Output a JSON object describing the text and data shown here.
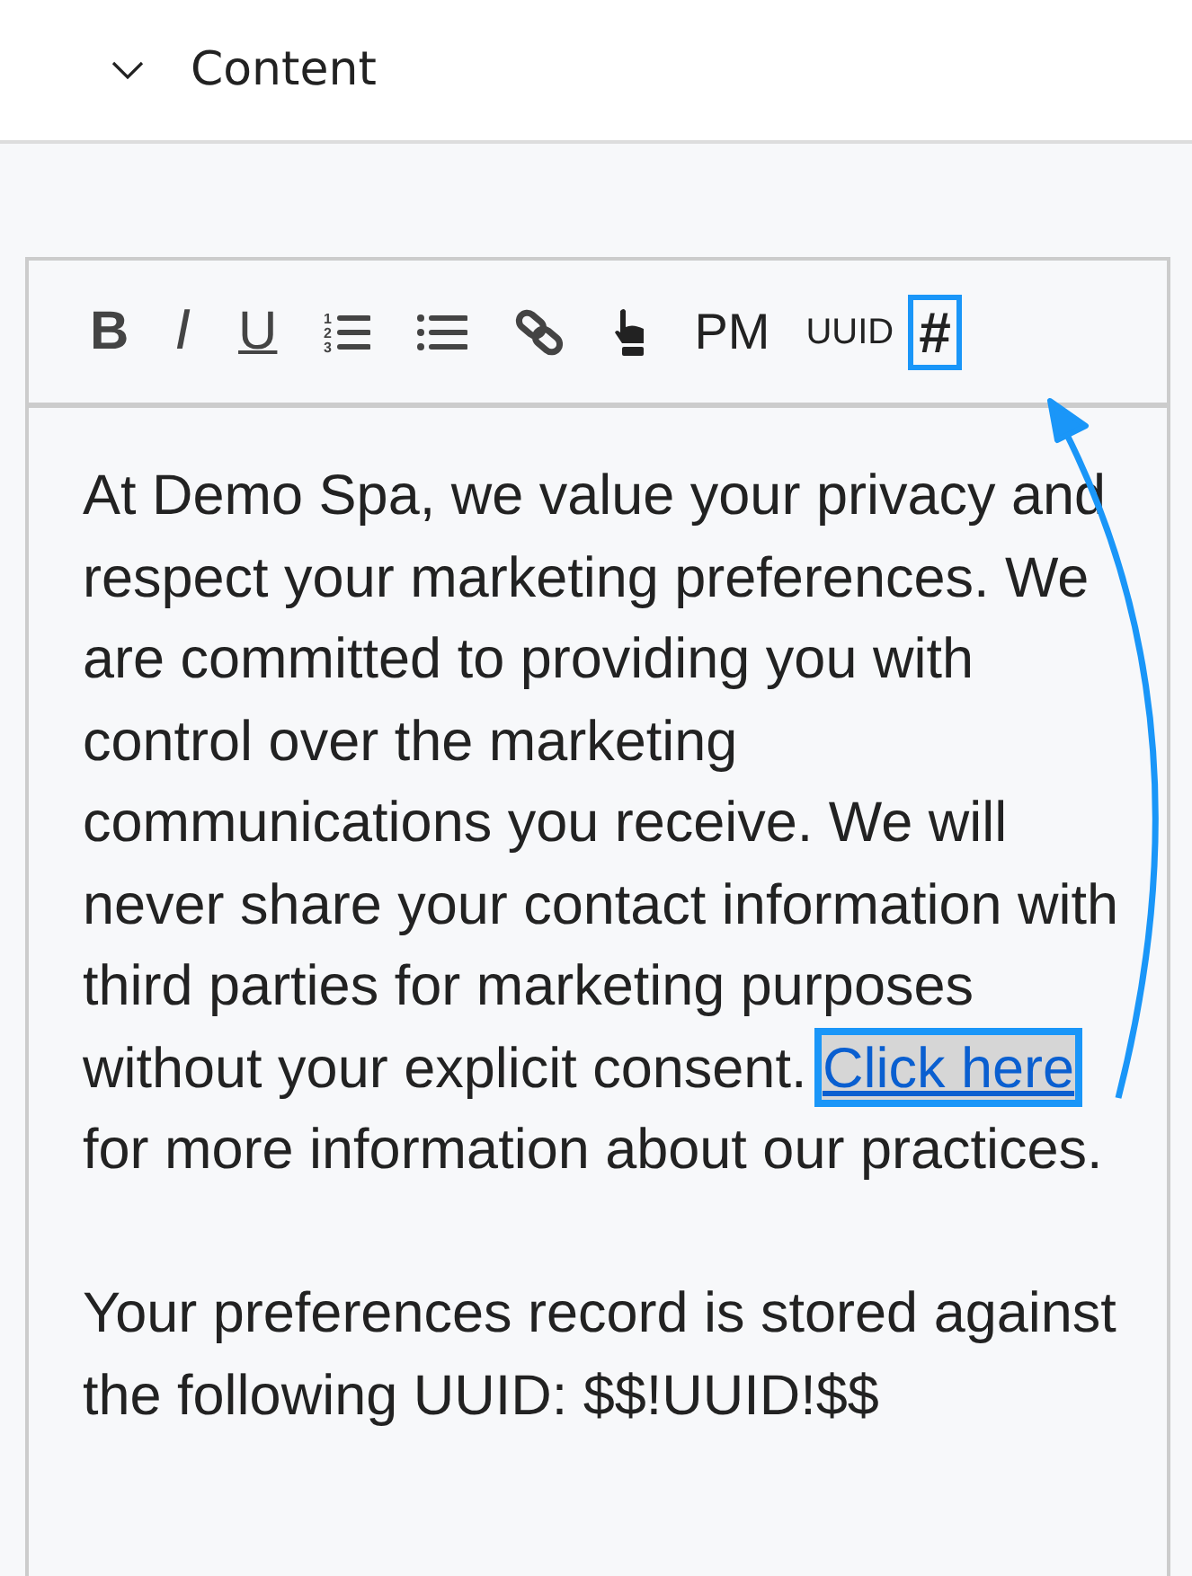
{
  "section": {
    "title": "Content",
    "expanded": true
  },
  "toolbar": [
    {
      "kind": "bold",
      "label": "B",
      "highlighted": false
    },
    {
      "kind": "italic",
      "label": "I",
      "highlighted": false
    },
    {
      "kind": "underline",
      "label": "U",
      "highlighted": false
    },
    {
      "kind": "numbered-list",
      "numbers": [
        "1",
        "2",
        "3"
      ],
      "highlighted": false
    },
    {
      "kind": "bullet-list",
      "highlighted": false
    },
    {
      "kind": "link",
      "highlighted": false
    },
    {
      "kind": "pointer",
      "highlighted": false
    },
    {
      "kind": "text",
      "label": "PM",
      "highlighted": false
    },
    {
      "kind": "small-text",
      "label": "UUID",
      "highlighted": false
    },
    {
      "kind": "hash",
      "label": "#",
      "highlighted": true
    }
  ],
  "paragraphs": [
    {
      "before": "At Demo Spa, we value your privacy and respect your marketing preferences. We are committed to providing you with control over the marketing communications you receive. We will never share your contact information with third parties for marketing purposes without your explicit consent.",
      "link": {
        "text": "Click here",
        "selected": true,
        "highlighted": true
      },
      "after": "for more information about our practices."
    },
    {
      "before": "Your preferences record is stored against the following UUID: $$!UUID!$$"
    }
  ],
  "annotation_arrow": true
}
